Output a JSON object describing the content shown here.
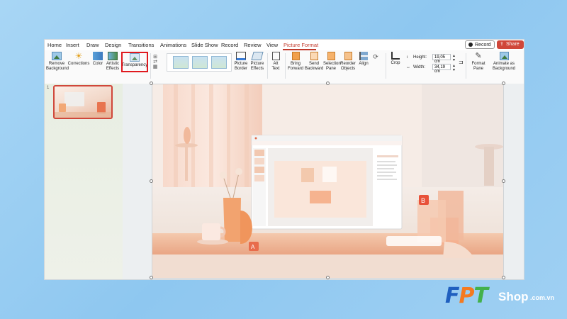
{
  "app": {
    "menu": [
      {
        "label": "Home"
      },
      {
        "label": "Insert"
      },
      {
        "label": "Draw"
      },
      {
        "label": "Design"
      },
      {
        "label": "Transitions"
      },
      {
        "label": "Animations"
      },
      {
        "label": "Slide Show"
      },
      {
        "label": "Record"
      },
      {
        "label": "Review"
      },
      {
        "label": "View"
      },
      {
        "label": "Picture Format"
      }
    ],
    "record_label": "Record",
    "share_label": "Share"
  },
  "ribbon": {
    "remove_background": "Remove Background",
    "corrections": "Corrections",
    "color": "Color",
    "artistic_effects": "Artistic Effects",
    "transparency": "Transparency",
    "picture_border": "Picture Border",
    "picture_effects": "Picture Effects",
    "alt_text": "Alt Text",
    "bring_forward": "Bring Forward",
    "send_backward": "Send Backward",
    "selection_pane": "Selection Pane",
    "reorder_objects": "Reorder Objects",
    "align": "Align",
    "crop": "Crop",
    "height_label": "Height:",
    "height_value": "19,05 cm",
    "width_label": "Width:",
    "width_value": "34,19 cm",
    "format_pane": "Format Pane",
    "animate_as_background": "Animate as Background"
  },
  "slides_panel": {
    "slide_number": "1"
  },
  "watermark": {
    "brand": "FPT",
    "shop": "Shop",
    "domain": ".com.vn",
    "colors": {
      "F": "#1f5fbf",
      "P": "#f47a20",
      "T": "#43b14b"
    }
  }
}
